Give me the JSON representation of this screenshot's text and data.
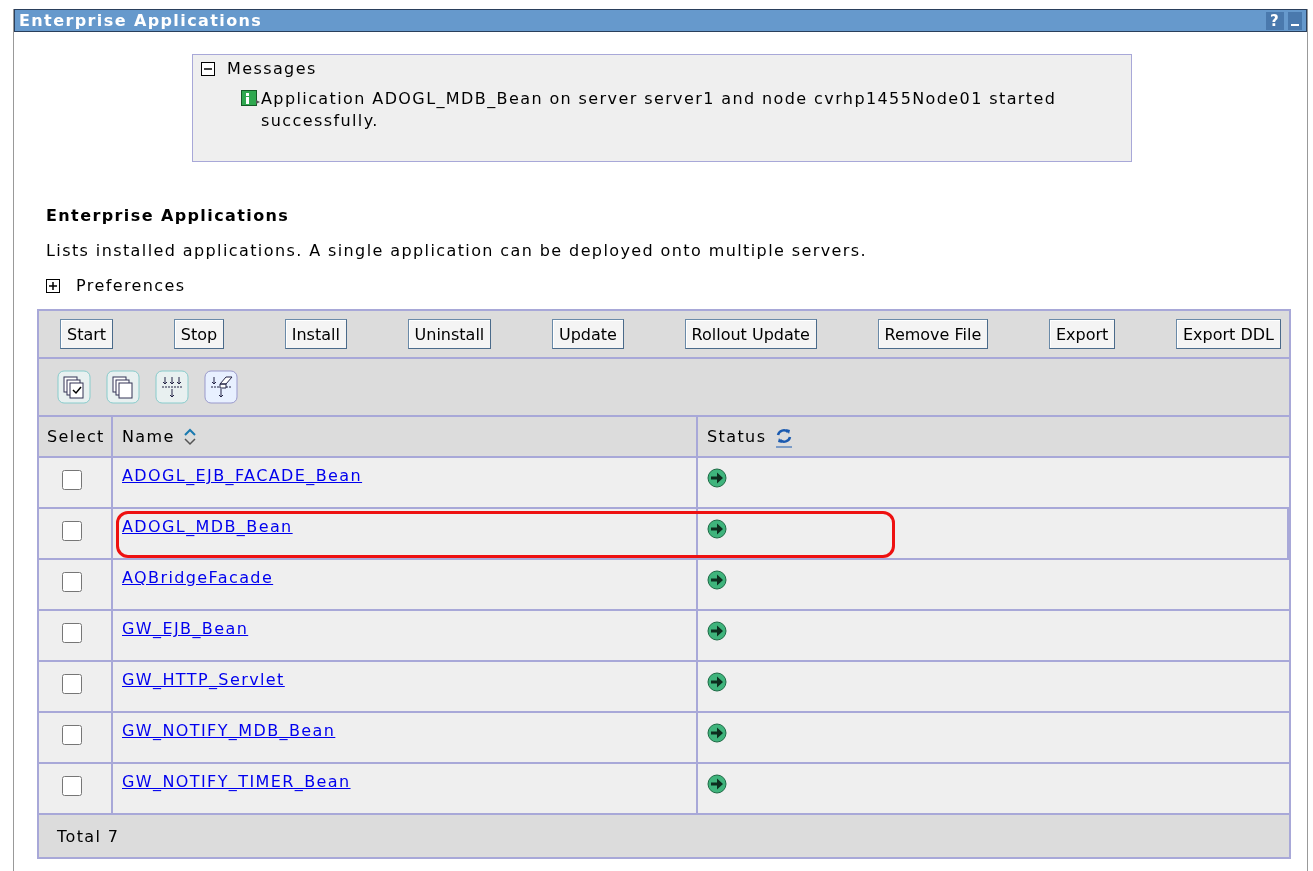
{
  "window": {
    "title": "Enterprise Applications",
    "help": "?"
  },
  "messages": {
    "title": "Messages",
    "expanded": true,
    "items": [
      {
        "text": "Application ADOGL_MDB_Bean on server server1 and node cvrhp1455Node01 started successfully."
      }
    ]
  },
  "heading": "Enterprise Applications",
  "description": "Lists installed applications. A single application can be deployed onto multiple servers.",
  "preferences": {
    "label": "Preferences",
    "expanded": false
  },
  "buttons": [
    "Start",
    "Stop",
    "Install",
    "Uninstall",
    "Update",
    "Rollout Update",
    "Remove File",
    "Export",
    "Export DDL"
  ],
  "table": {
    "columns": [
      "Select",
      "Name",
      "Status"
    ],
    "rows": [
      {
        "name": "ADOGL_EJB_FACADE_Bean",
        "checked": false,
        "kind": "started",
        "highlighted": false
      },
      {
        "name": "ADOGL_MDB_Bean",
        "checked": false,
        "kind": "started",
        "highlighted": true
      },
      {
        "name": "AQBridgeFacade",
        "checked": false,
        "kind": "started",
        "highlighted": false
      },
      {
        "name": "GW_EJB_Bean",
        "checked": false,
        "kind": "started",
        "highlighted": false
      },
      {
        "name": "GW_HTTP_Servlet",
        "checked": false,
        "kind": "started",
        "highlighted": false
      },
      {
        "name": "GW_NOTIFY_MDB_Bean",
        "checked": false,
        "kind": "started",
        "highlighted": false
      },
      {
        "name": "GW_NOTIFY_TIMER_Bean",
        "checked": false,
        "kind": "started",
        "highlighted": false
      }
    ],
    "total": "Total 7"
  }
}
